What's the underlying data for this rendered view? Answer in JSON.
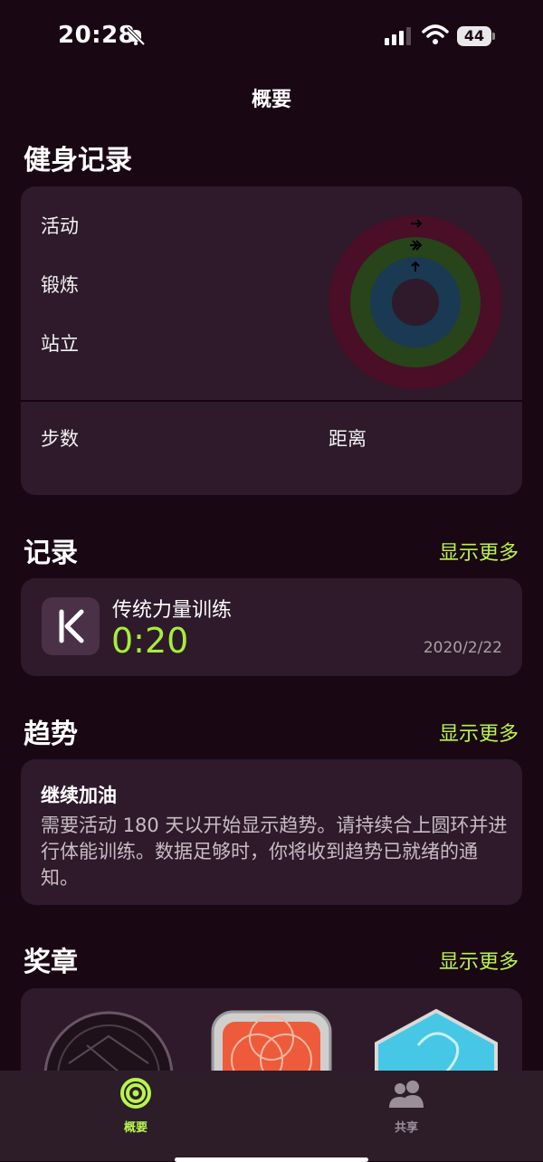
{
  "status_bar": {
    "time": "20:28",
    "battery": "44"
  },
  "nav": {
    "title": "概要"
  },
  "fitness": {
    "title": "健身记录",
    "rings": [
      "活动",
      "锻炼",
      "站立"
    ],
    "steps_label": "步数",
    "distance_label": "距离",
    "ring_colors": {
      "move": "#e5205c",
      "exercise": "#9be33a",
      "stand": "#3aa8e0"
    }
  },
  "records": {
    "title": "记录",
    "show_more": "显示更多",
    "item": {
      "name": "传统力量训练",
      "duration": "0:20",
      "date": "2020/2/22",
      "icon": "keep-app-icon"
    }
  },
  "trends": {
    "title": "趋势",
    "show_more": "显示更多",
    "card_title": "继续加油",
    "card_body": "需要活动 180 天以开始显示趋势。请持续合上圆环并进行体能训练。数据足够时，你将收到趋势已就绪的通知。"
  },
  "awards": {
    "title": "奖章",
    "show_more": "显示更多"
  },
  "tabbar": {
    "tabs": [
      {
        "label": "概要",
        "icon": "summary-rings-icon",
        "active": true
      },
      {
        "label": "共享",
        "icon": "sharing-people-icon",
        "active": false
      }
    ],
    "accent": "#b8f54a"
  }
}
